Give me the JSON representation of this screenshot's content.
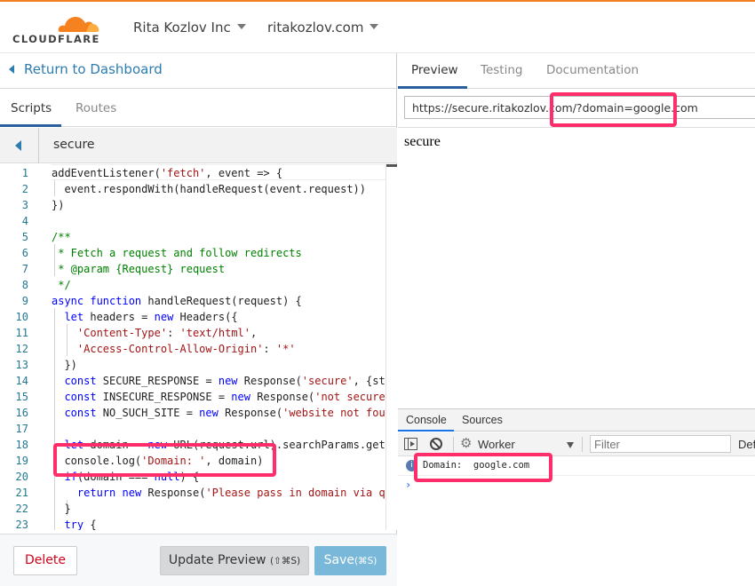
{
  "header": {
    "logo_text": "CLOUDFLARE",
    "account_name": "Rita Kozlov Inc",
    "zone_name": "ritakozlov.com",
    "brand_color": "#f38020"
  },
  "left_pane": {
    "return_label": "Return to Dashboard",
    "tabs": [
      {
        "label": "Scripts",
        "active": true
      },
      {
        "label": "Routes",
        "active": false
      }
    ],
    "script_name": "secure",
    "code_lines": [
      {
        "n": "1",
        "text": "addEventListener('fetch', event => {"
      },
      {
        "n": "2",
        "text": "  event.respondWith(handleRequest(event.request))"
      },
      {
        "n": "3",
        "text": "})"
      },
      {
        "n": "4",
        "text": ""
      },
      {
        "n": "5",
        "text": "/**"
      },
      {
        "n": "6",
        "text": " * Fetch a request and follow redirects"
      },
      {
        "n": "7",
        "text": " * @param {Request} request"
      },
      {
        "n": "8",
        "text": " */"
      },
      {
        "n": "9",
        "text": "async function handleRequest(request) {"
      },
      {
        "n": "10",
        "text": "  let headers = new Headers({"
      },
      {
        "n": "11",
        "text": "    'Content-Type': 'text/html',"
      },
      {
        "n": "12",
        "text": "    'Access-Control-Allow-Origin': '*'"
      },
      {
        "n": "13",
        "text": "  })"
      },
      {
        "n": "14",
        "text": "  const SECURE_RESPONSE = new Response('secure', {stat"
      },
      {
        "n": "15",
        "text": "  const INSECURE_RESPONSE = new Response('not secure',"
      },
      {
        "n": "16",
        "text": "  const NO_SUCH_SITE = new Response('website not found"
      },
      {
        "n": "17",
        "text": ""
      },
      {
        "n": "18",
        "text": "  let domain = new URL(request.url).searchParams.get('"
      },
      {
        "n": "19",
        "text": "  console.log('Domain: ', domain)"
      },
      {
        "n": "20",
        "text": "  if(domain === null) {"
      },
      {
        "n": "21",
        "text": "    return new Response('Please pass in domain via que"
      },
      {
        "n": "22",
        "text": "  }"
      },
      {
        "n": "23",
        "text": "  try {"
      }
    ],
    "buttons": {
      "delete": "Delete",
      "update_preview": "Update Preview",
      "update_preview_shortcut": "(⇧⌘S)",
      "save": "Save",
      "save_shortcut": "(⌘S)"
    }
  },
  "right_pane": {
    "tabs": [
      {
        "label": "Preview",
        "active": true
      },
      {
        "label": "Testing",
        "active": false
      },
      {
        "label": "Documentation",
        "active": false
      }
    ],
    "url_value": "https://secure.ritakozlov.com/?domain=google.com",
    "preview_output": "secure",
    "devtools": {
      "tabs": [
        {
          "label": "Console",
          "active": true
        },
        {
          "label": "Sources",
          "active": false
        }
      ],
      "context": "Worker",
      "filter_placeholder": "Filter",
      "levels_label": "Default levels",
      "messages": [
        {
          "level": "info",
          "text": "Domain:  google.com"
        }
      ],
      "prompt": "›"
    }
  },
  "annotations": {
    "highlight_color": "#ff2e6a"
  }
}
